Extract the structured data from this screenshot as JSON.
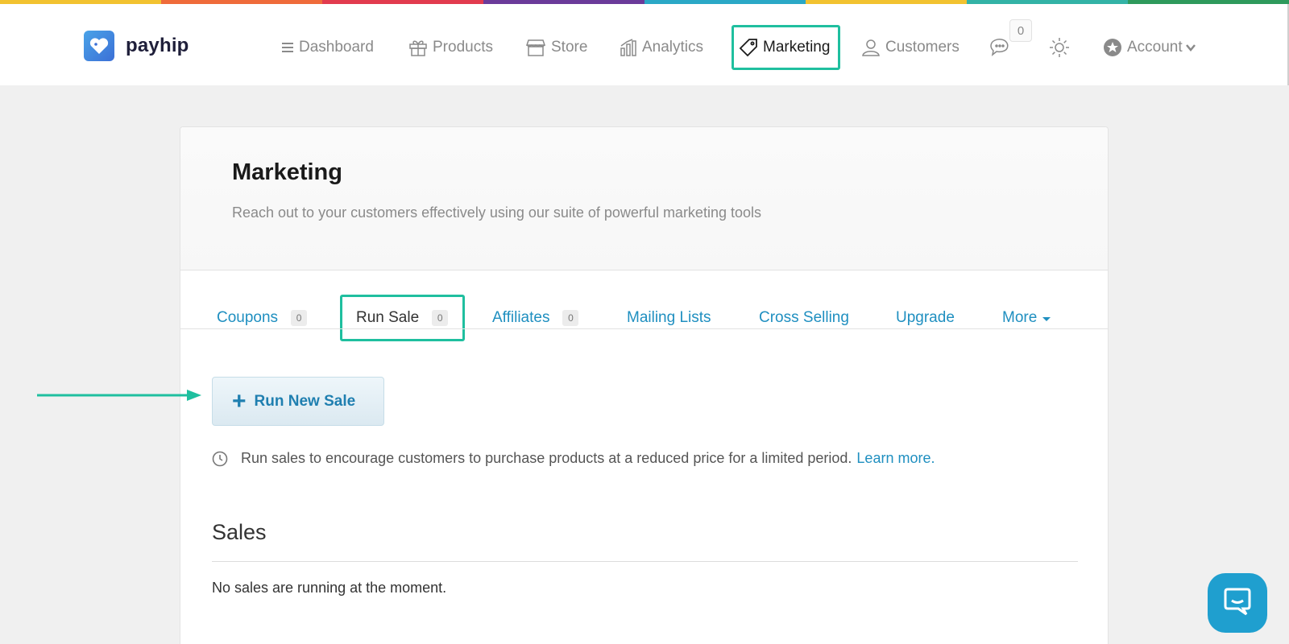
{
  "colors": {
    "accent_highlight": "#1fbf9f",
    "link_blue": "#1f8fc0",
    "brand": "#3b6fd6",
    "rainbow": [
      "#f2c230",
      "#ef6b3a",
      "#e23b4e",
      "#6b3b9a",
      "#2aa8c6",
      "#f2c230",
      "#33b3a6",
      "#2e9a5c"
    ]
  },
  "brand": {
    "name": "payhip",
    "logo_icon": "heart-tag-icon"
  },
  "nav": {
    "items": [
      {
        "label": "Dashboard",
        "icon": "menu-icon"
      },
      {
        "label": "Products",
        "icon": "gift-icon"
      },
      {
        "label": "Store",
        "icon": "store-icon"
      },
      {
        "label": "Analytics",
        "icon": "bar-chart-icon"
      },
      {
        "label": "Marketing",
        "icon": "tag-icon",
        "active": true
      },
      {
        "label": "Customers",
        "icon": "user-icon"
      }
    ],
    "messages_count": "0",
    "account_label": "Account"
  },
  "page": {
    "title": "Marketing",
    "subtitle": "Reach out to your customers effectively using our suite of powerful marketing tools"
  },
  "tabs": [
    {
      "label": "Coupons",
      "count": "0"
    },
    {
      "label": "Run Sale",
      "count": "0",
      "active": true
    },
    {
      "label": "Affiliates",
      "count": "0"
    },
    {
      "label": "Mailing Lists"
    },
    {
      "label": "Cross Selling"
    },
    {
      "label": "Upgrade"
    },
    {
      "label": "More"
    }
  ],
  "content": {
    "run_button_label": "Run New Sale",
    "info_text": "Run sales to encourage customers to purchase products at a reduced price for a limited period.",
    "learn_more": "Learn more.",
    "sales_heading": "Sales",
    "empty_text": "No sales are running at the moment."
  }
}
